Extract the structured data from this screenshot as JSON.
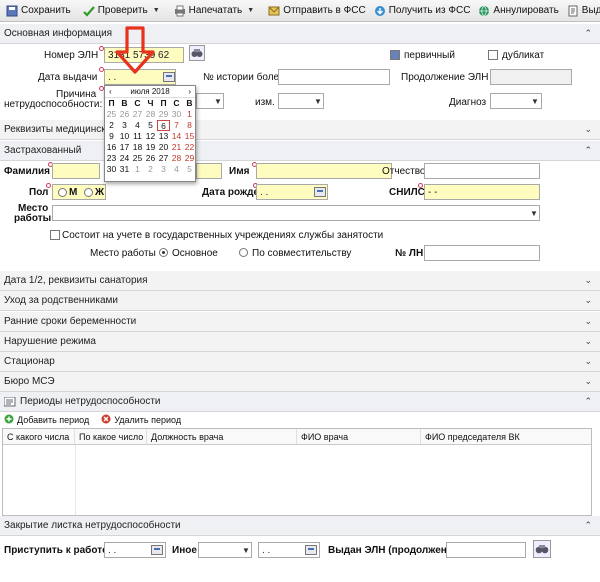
{
  "toolbar": {
    "save": "Сохранить",
    "check": "Проверить",
    "print": "Напечатать",
    "send_fss": "Отправить в ФСС",
    "get_fss": "Получить из ФСС",
    "cancel": "Аннулировать",
    "issue": "Выдать ЭЛН-п"
  },
  "sections": {
    "main_info": "Основная информация",
    "med_org": "Реквизиты медицинской",
    "insured": "Застрахованный",
    "dates_sanatorium": "Дата 1/2, реквизиты санатория",
    "care": "Уход за родственниками",
    "pregnancy": "Ранние сроки беременности",
    "violation": "Нарушение режима",
    "hospital": "Стационар",
    "mse": "Бюро МСЭ",
    "periods": "Периоды нетрудоспособности",
    "closing": "Закрытие листка нетрудоспособности"
  },
  "main": {
    "eln_label": "Номер ЭЛН",
    "eln_value": "3131 5739 62",
    "primary_label": "первичный",
    "duplicate_label": "дубликат",
    "issue_date_label": "Дата выдачи",
    "issue_date_value": ". .",
    "history_label": "№ истории болезни",
    "continuation_label": "Продолжение ЭЛН",
    "reason_label_1": "Причина",
    "reason_label_2": "нетрудоспособности:",
    "change_label": "изм.",
    "diagnosis_label": "Диагноз"
  },
  "calendar": {
    "month": "июля 2018",
    "prev": "‹",
    "next": "›",
    "dow": [
      "П",
      "В",
      "С",
      "Ч",
      "П",
      "С",
      "В"
    ],
    "weeks": [
      [
        "25",
        "26",
        "27",
        "28",
        "29",
        "30",
        "1"
      ],
      [
        "2",
        "3",
        "4",
        "5",
        "6",
        "7",
        "8"
      ],
      [
        "9",
        "10",
        "11",
        "12",
        "13",
        "14",
        "15"
      ],
      [
        "16",
        "17",
        "18",
        "19",
        "20",
        "21",
        "22"
      ],
      [
        "23",
        "24",
        "25",
        "26",
        "27",
        "28",
        "29"
      ],
      [
        "30",
        "31",
        "1",
        "2",
        "3",
        "4",
        "5"
      ]
    ],
    "selected": "6"
  },
  "insured": {
    "surname_label": "Фамилия",
    "name_label": "Имя",
    "patronymic_label": "Отчество",
    "sex_label": "Пол",
    "male": "М",
    "female": "Ж",
    "dob_label": "Дата рождения",
    "dob_value": ". .",
    "snils_label": "СНИЛС",
    "snils_value": "-    -",
    "work_label_1": "Место",
    "work_label_2": "работы",
    "employment_label": "Состоит на учете в государственных учреждениях службы занятости",
    "workplace_label": "Место работы",
    "main_work": "Основное",
    "part_time": "По совместительству",
    "ln_label": "№ ЛН"
  },
  "periods": {
    "add": "Добавить период",
    "delete": "Удалить период",
    "columns": [
      "С какого числа",
      "По какое число",
      "Должность врача",
      "ФИО врача",
      "ФИО председателя ВК"
    ]
  },
  "closing": {
    "start_work_label": "Приступить к работе с",
    "start_work_value": ". .",
    "other_label": "Иное",
    "other_date_value": ". .",
    "issued_label": "Выдан ЭЛН (продолжение)"
  },
  "colors": {
    "required_fill": "#fffcc0",
    "arrow": "#e8321e",
    "required_dot": "#d23a5a"
  }
}
